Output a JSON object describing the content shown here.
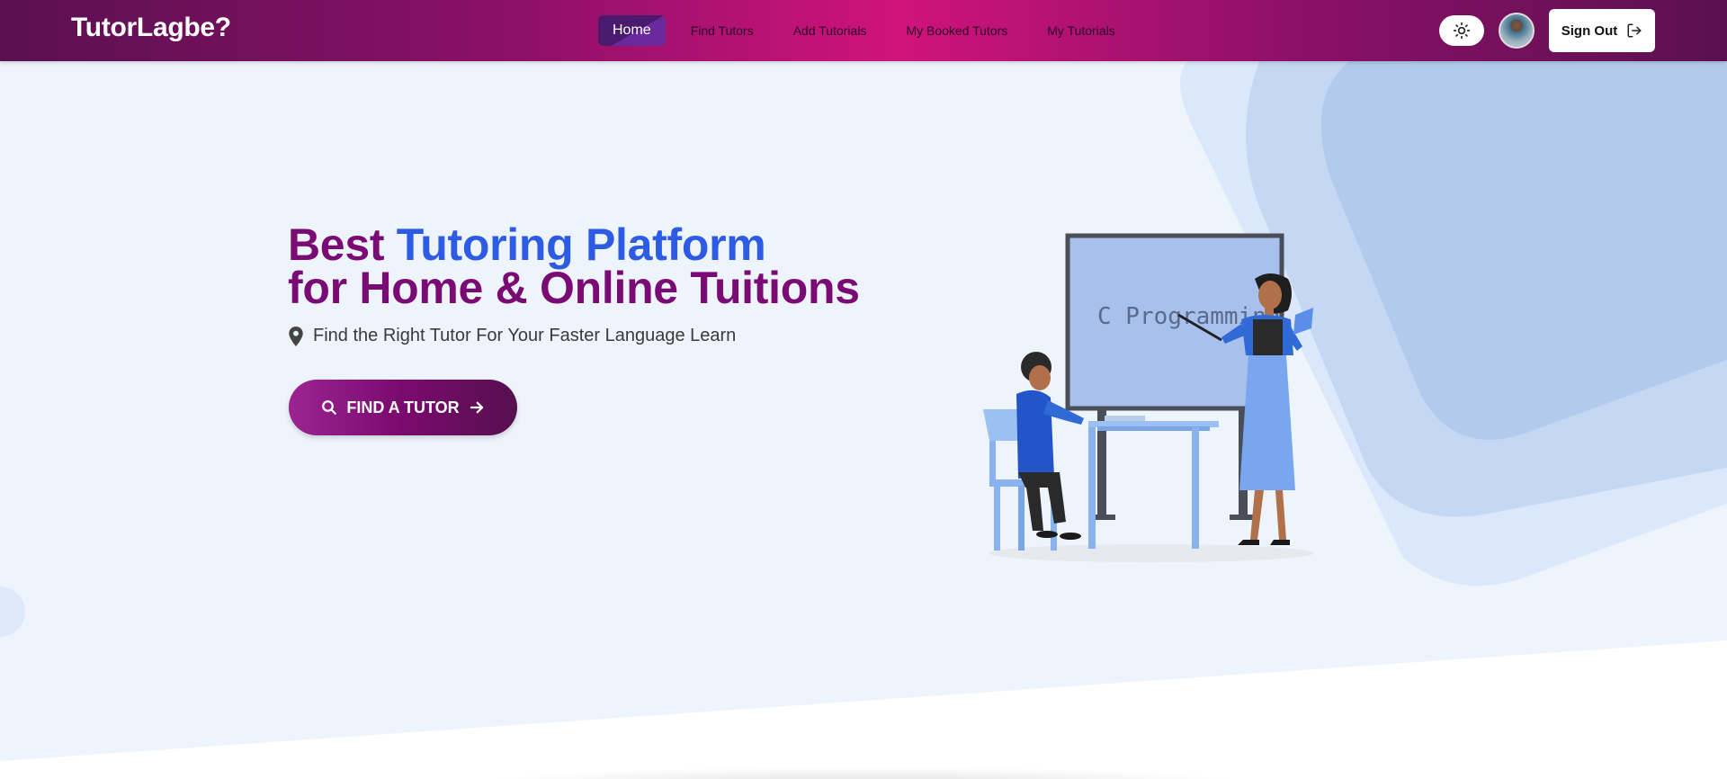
{
  "brand": "TutorLagbe?",
  "nav": {
    "items": [
      {
        "label": "Home",
        "active": true
      },
      {
        "label": "Find Tutors",
        "active": false
      },
      {
        "label": "Add Tutorials",
        "active": false
      },
      {
        "label": "My Booked Tutors",
        "active": false
      },
      {
        "label": "My Tutorials",
        "active": false
      }
    ],
    "theme_icon": "sun-icon",
    "signout_label": "Sign Out",
    "signout_icon": "logout-icon"
  },
  "hero": {
    "title_part1": "Best ",
    "title_highlight": "Tutoring Platform",
    "title_line2": "for Home & Online Tuitions",
    "subtitle": "Find the Right Tutor For Your Faster Language Learn",
    "subtitle_icon": "location-pin-icon",
    "cta_label": "FIND A TUTOR",
    "cta_icons": [
      "search-icon",
      "arrow-right-icon"
    ]
  },
  "illustration": {
    "board_text": "C Programming"
  },
  "colors": {
    "brand_purple": "#7a0a74",
    "accent_blue": "#2d5be3",
    "nav_pink": "#d0137b"
  }
}
